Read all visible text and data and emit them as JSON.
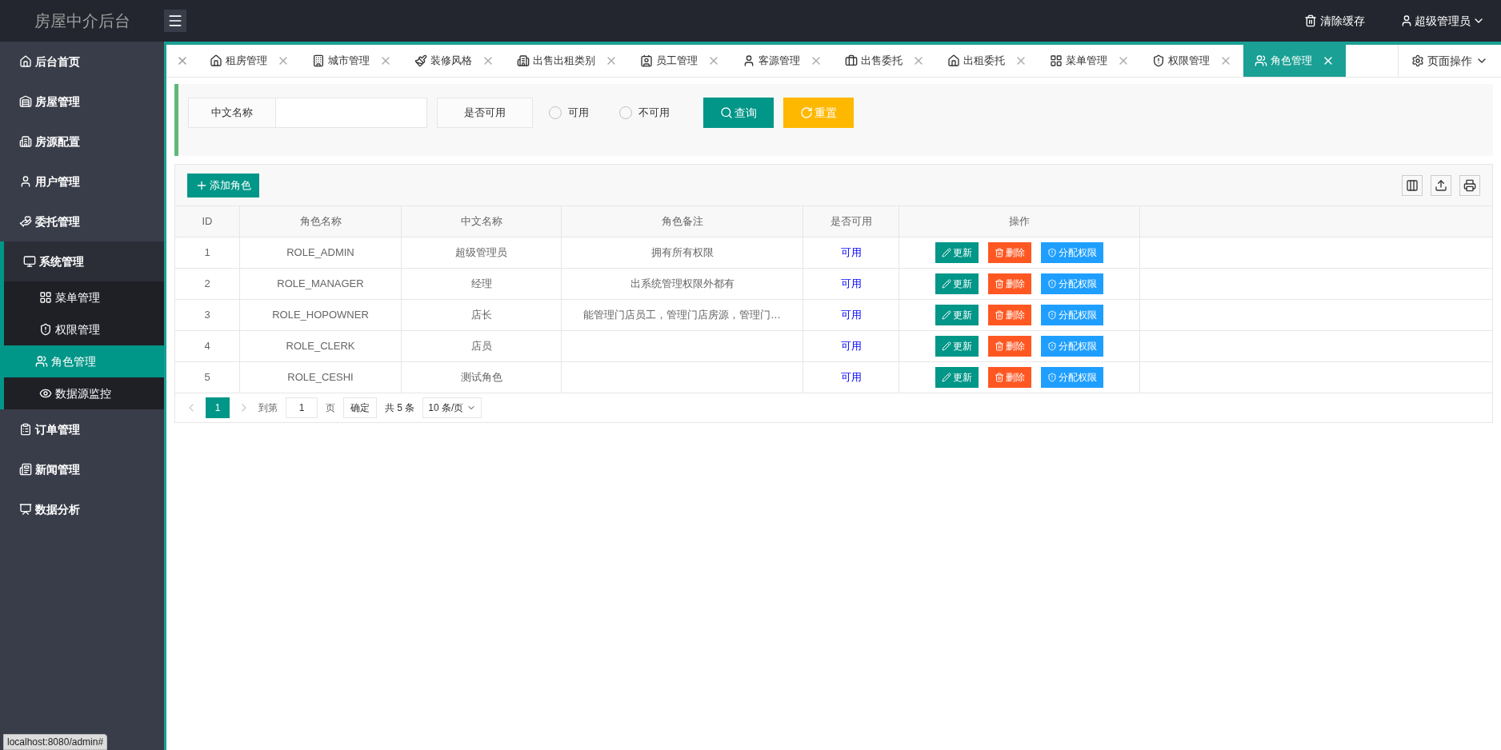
{
  "app_title": "房屋中介后台",
  "header": {
    "clear_cache": "清除缓存",
    "user": "超级管理员"
  },
  "sidebar": {
    "items": [
      {
        "label": "后台首页",
        "selected": false
      },
      {
        "label": "房屋管理",
        "selected": false
      },
      {
        "label": "房源配置",
        "selected": false
      },
      {
        "label": "用户管理",
        "selected": false
      },
      {
        "label": "委托管理",
        "selected": false
      },
      {
        "label": "系统管理",
        "selected": false,
        "expanded": true,
        "children": [
          {
            "label": "菜单管理",
            "selected": false
          },
          {
            "label": "权限管理",
            "selected": false
          },
          {
            "label": "角色管理",
            "selected": true
          },
          {
            "label": "数据源监控",
            "selected": false
          }
        ]
      },
      {
        "label": "订单管理",
        "selected": false
      },
      {
        "label": "新闻管理",
        "selected": false
      },
      {
        "label": "数据分析",
        "selected": false
      }
    ]
  },
  "tabs": [
    {
      "label": "租房管理",
      "selected": false
    },
    {
      "label": "城市管理",
      "selected": false
    },
    {
      "label": "装修风格",
      "selected": false
    },
    {
      "label": "出售出租类别",
      "selected": false
    },
    {
      "label": "员工管理",
      "selected": false
    },
    {
      "label": "客源管理",
      "selected": false
    },
    {
      "label": "出售委托",
      "selected": false
    },
    {
      "label": "出租委托",
      "selected": false
    },
    {
      "label": "菜单管理",
      "selected": false
    },
    {
      "label": "权限管理",
      "selected": false
    },
    {
      "label": "角色管理",
      "selected": true
    }
  ],
  "page_actions": "页面操作",
  "filter": {
    "name_label": "中文名称",
    "enabled_label": "是否可用",
    "radios": [
      {
        "label": "可用",
        "selected": false
      },
      {
        "label": "不可用",
        "selected": false
      }
    ],
    "search": "查询",
    "reset": "重置"
  },
  "toolbar": {
    "add": "添加角色"
  },
  "table": {
    "columns": [
      "ID",
      "角色名称",
      "中文名称",
      "角色备注",
      "是否可用",
      "操作"
    ],
    "rows": [
      {
        "id": "1",
        "name": "ROLE_ADMIN",
        "cn_name": "超级管理员",
        "remark": "拥有所有权限",
        "enabled": "可用",
        "actions": [
          "更新",
          "删除",
          "分配权限"
        ]
      },
      {
        "id": "2",
        "name": "ROLE_MANAGER",
        "cn_name": "经理",
        "remark": "出系统管理权限外都有",
        "enabled": "可用",
        "actions": [
          "更新",
          "删除",
          "分配权限"
        ]
      },
      {
        "id": "3",
        "name": "ROLE_HOPOWNER",
        "cn_name": "店长",
        "remark": "能管理门店员工，管理门店房源，管理门…",
        "enabled": "可用",
        "actions": [
          "更新",
          "删除",
          "分配权限"
        ]
      },
      {
        "id": "4",
        "name": "ROLE_CLERK",
        "cn_name": "店员",
        "enabled": "可用",
        "actions": [
          "更新",
          "删除",
          "分配权限"
        ]
      },
      {
        "id": "5",
        "name": "ROLE_CESHI",
        "cn_name": "测试角色",
        "enabled": "可用",
        "actions": [
          "更新",
          "删除",
          "分配权限"
        ]
      }
    ]
  },
  "pagination": {
    "pages": [
      {
        "label": "1",
        "selected": true
      }
    ],
    "goto": "到第",
    "page_value": "1",
    "page_unit": "页",
    "confirm": "确定",
    "total": "共 5 条",
    "page_size": "10 条/页"
  },
  "status_bar": "localhost:8080/admin#"
}
